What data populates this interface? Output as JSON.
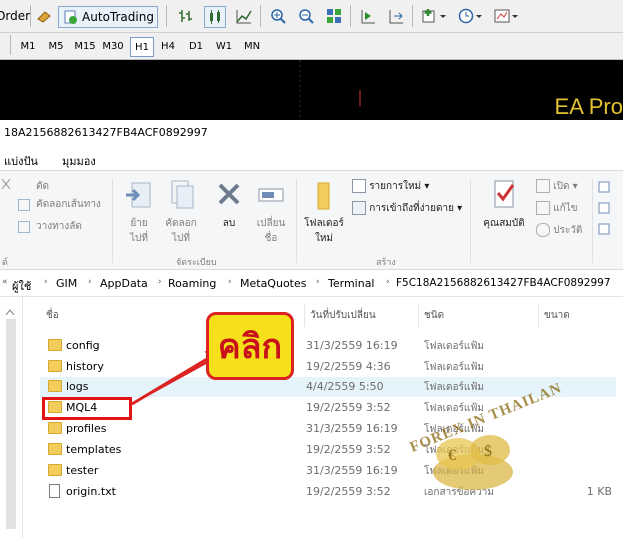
{
  "mt4": {
    "order_label": "Order",
    "autotrading_label": "AutoTrading",
    "timeframes": [
      "M1",
      "M5",
      "M15",
      "M30",
      "H1",
      "H4",
      "D1",
      "W1",
      "MN"
    ],
    "active_timeframe": "H1",
    "chart_title": "EA Pro"
  },
  "explorer": {
    "window_title": "18A2156882613427FB4ACF0892997",
    "ribbon_tabs": [
      "แบ่งปัน",
      "มุมมอง"
    ],
    "ribbon": {
      "cut": "ตัด",
      "copy_path": "คัดลอกเส้นทาง",
      "paste_shortcut": "วางทางลัด",
      "clipboard_group_tail": "ด์",
      "move_to": "ย้าย",
      "move_to_2": "ไปที่",
      "copy_to": "คัดลอก",
      "copy_to_2": "ไปที่",
      "delete": "ลบ",
      "rename": "เปลี่ยน",
      "rename_2": "ชื่อ",
      "organize_group": "จัดระเบียบ",
      "new_folder": "โฟลเดอร์",
      "new_folder_2": "ใหม่",
      "new_item": "รายการใหม่",
      "easy_access": "การเข้าถึงที่ง่ายดาย",
      "new_group": "สร้าง",
      "properties": "คุณสมบัติ",
      "open": "เปิด",
      "edit": "แก้ไข",
      "history": "ประวัติ"
    },
    "address": [
      "ผู้ใช้",
      "GIM",
      "AppData",
      "Roaming",
      "MetaQuotes",
      "Terminal",
      "F5C18A2156882613427FB4ACF0892997"
    ],
    "columns": {
      "name": "ชื่อ",
      "date": "วันที่ปรับเปลี่ยน",
      "type": "ชนิด",
      "size": "ขนาด"
    },
    "files": [
      {
        "name": "config",
        "date": "31/3/2559 16:19",
        "type": "โฟลเดอร์แฟ้ม",
        "size": "",
        "kind": "folder"
      },
      {
        "name": "history",
        "date": "19/2/2559 4:36",
        "type": "โฟลเดอร์แฟ้ม",
        "size": "",
        "kind": "folder"
      },
      {
        "name": "logs",
        "date": "4/4/2559 5:50",
        "type": "โฟลเดอร์แฟ้ม",
        "size": "",
        "kind": "folder"
      },
      {
        "name": "MQL4",
        "date": "19/2/2559 3:52",
        "type": "โฟลเดอร์แฟ้ม",
        "size": "",
        "kind": "folder"
      },
      {
        "name": "profiles",
        "date": "31/3/2559 16:19",
        "type": "โฟลเดอร์แฟ้ม",
        "size": "",
        "kind": "folder"
      },
      {
        "name": "templates",
        "date": "19/2/2559 3:52",
        "type": "โฟลเดอร์แฟ้ม",
        "size": "",
        "kind": "folder"
      },
      {
        "name": "tester",
        "date": "31/3/2559 16:19",
        "type": "โฟลเดอร์แฟ้ม",
        "size": "",
        "kind": "folder"
      },
      {
        "name": "origin.txt",
        "date": "19/2/2559 3:52",
        "type": "เอกสารข้อความ",
        "size": "1 KB",
        "kind": "file"
      }
    ]
  },
  "annotation": {
    "callout_text": "คลิก",
    "watermark": "FOREX IN THAILAN"
  },
  "colors": {
    "callout_fill": "#f5e01a",
    "callout_text": "#c9111b",
    "highlight_box": "#e21414",
    "folder": "#f2cd5d",
    "chart_bg": "#000000"
  }
}
